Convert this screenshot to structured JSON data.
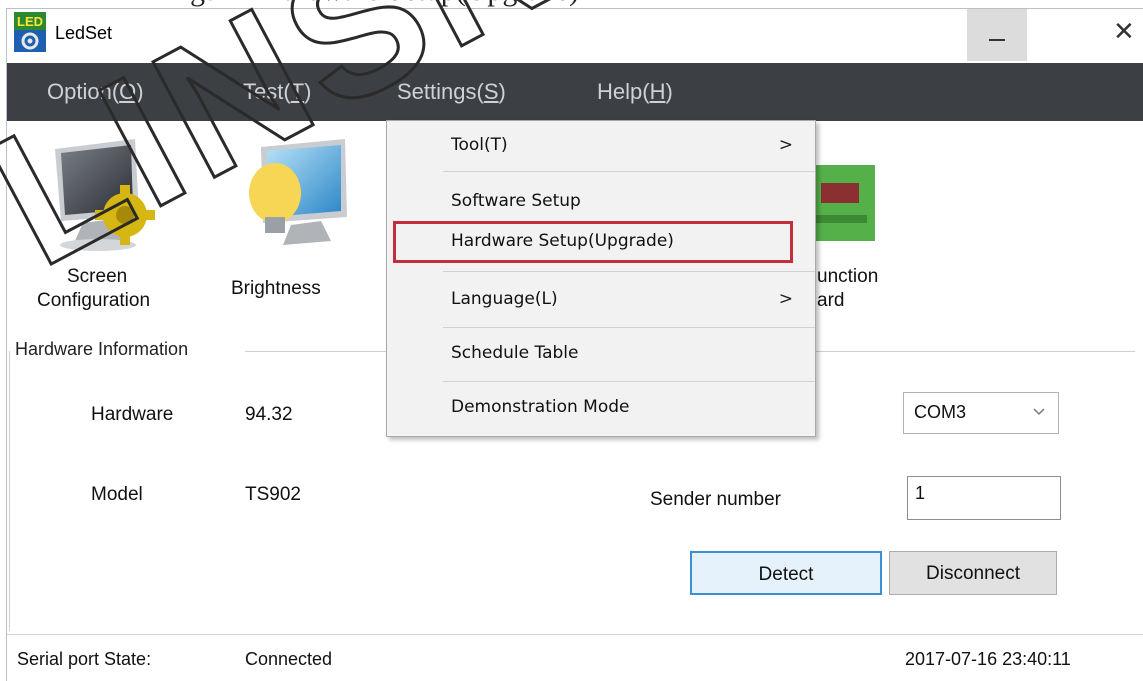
{
  "caption": "ngs → Hardware Setup(Upgrade)",
  "window": {
    "title": "LedSet",
    "app_icon_text": "LED",
    "minimize_label": "—",
    "close_label": "✕"
  },
  "menubar": {
    "items": [
      {
        "label": "Option(",
        "key": "O",
        "suffix": ")"
      },
      {
        "label": "Test(",
        "key": "T",
        "suffix": ")"
      },
      {
        "label": "Settings(",
        "key": "S",
        "suffix": ")"
      },
      {
        "label": "Help(",
        "key": "H",
        "suffix": ")"
      }
    ]
  },
  "toolbar": {
    "screen_config_line1": "Screen",
    "screen_config_line2": "Configuration",
    "brightness": "Brightness",
    "function_card_line1": "unction",
    "function_card_line2": "ard"
  },
  "settings_menu": {
    "items": [
      {
        "label": "Tool(T)",
        "arrow": ">"
      },
      {
        "label": "Software Setup",
        "arrow": ""
      },
      {
        "label": "Hardware Setup(Upgrade)",
        "arrow": ""
      },
      {
        "label": "Language(L)",
        "arrow": ">"
      },
      {
        "label": "Schedule Table",
        "arrow": ""
      },
      {
        "label": "Demonstration Mode",
        "arrow": ""
      }
    ],
    "highlighted": "Hardware Setup(Upgrade)"
  },
  "hardware_info": {
    "group_label": "Hardware Information",
    "hardware_label": "Hardware",
    "hardware_value": "94.32",
    "model_label": "Model",
    "model_value": "TS902",
    "port_selected": "COM3",
    "sender_label": "Sender number",
    "sender_value": "1",
    "detect_label": "Detect",
    "disconnect_label": "Disconnect"
  },
  "status": {
    "port_state_label": "Serial port State:",
    "port_state_value": "Connected",
    "timestamp": "2017-07-16 23:40:11"
  },
  "watermark_text": "LINSN",
  "colors": {
    "menubar_bg": "#3c3f44",
    "menu_text": "#cfd1d4",
    "highlight_border": "#c0303a",
    "detect_border": "#3a8fd6"
  }
}
